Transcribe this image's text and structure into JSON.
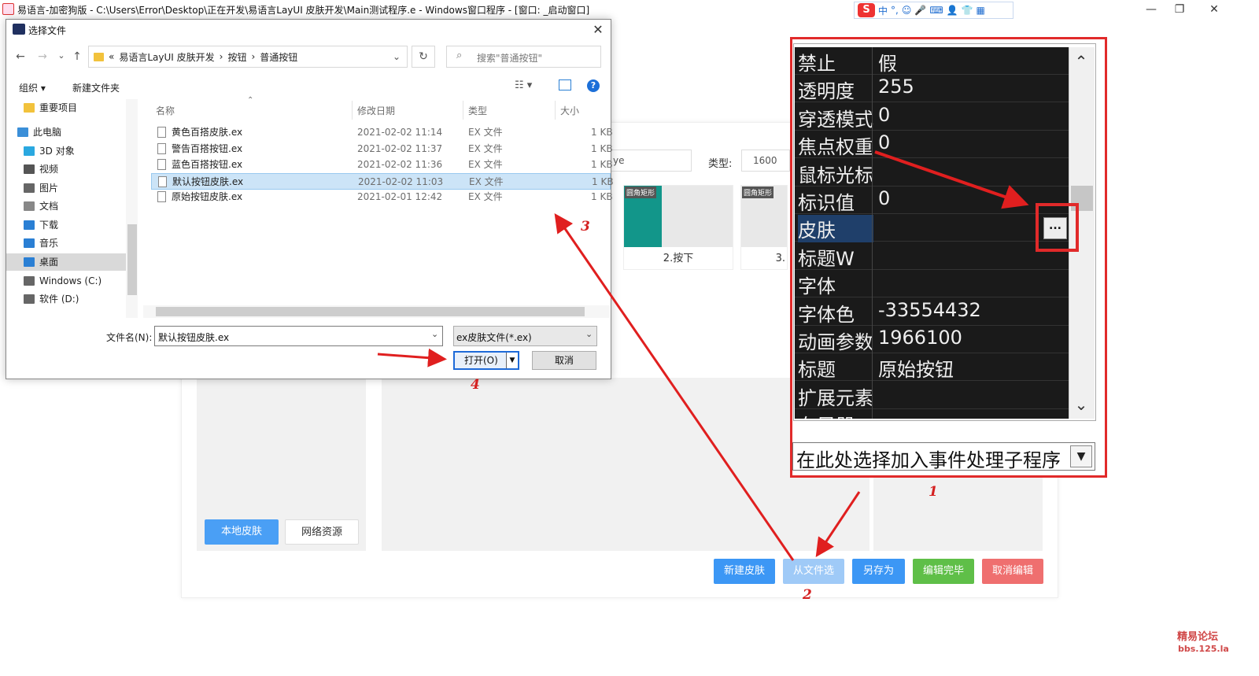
{
  "window": {
    "title": "易语言-加密狗版 - C:\\Users\\Error\\Desktop\\正在开发\\易语言LayUI 皮肤开发\\Main测试程序.e - Windows窗口程序 - [窗口: _启动窗口]",
    "minimize_glyph": "—",
    "maximize_glyph": "❐",
    "close_glyph": "✕"
  },
  "ime": {
    "logo": "S",
    "items": [
      "中",
      "°,",
      "☺",
      "🎤",
      "⌨",
      "👤",
      "👕",
      "▦"
    ]
  },
  "app": {
    "type_label": "类型:",
    "type_value": "1600",
    "name_value": "ye",
    "thumbs": [
      {
        "tag": "圆角矩形",
        "label": "2.按下",
        "color": "#12968a"
      },
      {
        "tag": "圆角矩形",
        "label": "3.",
        "color": "#e2e2e2"
      }
    ],
    "buttons": {
      "local_skin": "本地皮肤",
      "net_resource": "网络资源",
      "new_skin": "新建皮肤",
      "from_file": "从文件选",
      "save_as": "另存为",
      "edit_done": "编辑完毕",
      "cancel_edit": "取消编辑"
    }
  },
  "properties": {
    "rows": [
      {
        "name": "禁止",
        "value": "假"
      },
      {
        "name": "透明度",
        "value": "255"
      },
      {
        "name": "穿透模式",
        "value": "0"
      },
      {
        "name": "焦点权重",
        "value": "0"
      },
      {
        "name": "鼠标光标",
        "value": ""
      },
      {
        "name": "标识值",
        "value": "0"
      },
      {
        "name": "皮肤",
        "value": "",
        "selected": true
      },
      {
        "name": "标题W",
        "value": ""
      },
      {
        "name": "字体",
        "value": ""
      },
      {
        "name": "字体色",
        "value": "-33554432"
      },
      {
        "name": "动画参数",
        "value": "1966100"
      },
      {
        "name": "标题",
        "value": "原始按钮"
      },
      {
        "name": "扩展元素",
        "value": ""
      },
      {
        "name": "布局器",
        "value": ""
      }
    ],
    "ellipsis": "...",
    "scroll_up": "⌃",
    "scroll_down": "⌄",
    "event_select": "在此处选择加入事件处理子程序",
    "event_arrow": "▼"
  },
  "dialog": {
    "title": "选择文件",
    "close": "✕",
    "back": "←",
    "forward": "→",
    "history": "⌄",
    "up": "↑",
    "address": [
      "«",
      "易语言LayUI 皮肤开发",
      "›",
      "按钮",
      "›",
      "普通按钮"
    ],
    "address_dropdown": "⌄",
    "refresh": "↻",
    "search_icon": "⌕",
    "search_placeholder": "搜索\"普通按钮\"",
    "organize": "组织 ▾",
    "new_folder": "新建文件夹",
    "view_glyph": "☷ ▾",
    "help": "?",
    "nav": [
      {
        "label": "重要项目",
        "color": "#f2c23c"
      },
      {
        "label": "此电脑",
        "color": "#3b8fd8"
      },
      {
        "label": "3D 对象",
        "color": "#2aa8e0"
      },
      {
        "label": "视频",
        "color": "#555"
      },
      {
        "label": "图片",
        "color": "#666"
      },
      {
        "label": "文档",
        "color": "#888"
      },
      {
        "label": "下载",
        "color": "#2a7fd4"
      },
      {
        "label": "音乐",
        "color": "#2a7fd4"
      },
      {
        "label": "桌面",
        "color": "#2a7fd4",
        "selected": true
      },
      {
        "label": "Windows (C:)",
        "color": "#666"
      },
      {
        "label": "软件 (D:)",
        "color": "#666"
      }
    ],
    "columns": {
      "name": "名称",
      "date": "修改日期",
      "type": "类型",
      "size": "大小"
    },
    "sort_glyph": "⌃",
    "files": [
      {
        "name": "黄色百搭皮肤.ex",
        "date": "2021-02-02 11:14",
        "type": "EX 文件",
        "size": "1 KB"
      },
      {
        "name": "警告百搭按钮.ex",
        "date": "2021-02-02 11:37",
        "type": "EX 文件",
        "size": "1 KB"
      },
      {
        "name": "蓝色百搭按钮.ex",
        "date": "2021-02-02 11:36",
        "type": "EX 文件",
        "size": "1 KB"
      },
      {
        "name": "默认按钮皮肤.ex",
        "date": "2021-02-02 11:03",
        "type": "EX 文件",
        "size": "1 KB",
        "selected": true
      },
      {
        "name": "原始按钮皮肤.ex",
        "date": "2021-02-01 12:42",
        "type": "EX 文件",
        "size": "1 KB"
      }
    ],
    "filename_label": "文件名(N):",
    "filename_value": "默认按钮皮肤.ex",
    "filter_value": "ex皮肤文件(*.ex)",
    "dropdown_glyph": "⌄",
    "open_button": "打开(O)",
    "open_split": "▼",
    "cancel_button": "取消"
  },
  "annotations": {
    "n1": "1",
    "n2": "2",
    "n3": "3",
    "n4": "4",
    "color": "#e01f1f"
  },
  "watermark": {
    "line1": "精易论坛",
    "line2": "bbs.125.la"
  }
}
